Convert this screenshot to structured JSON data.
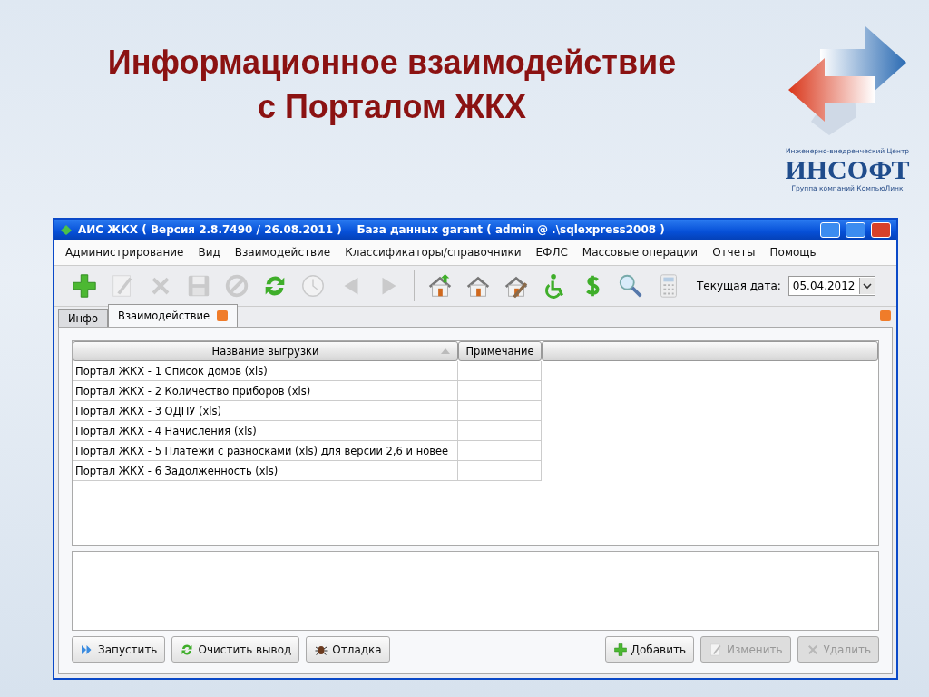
{
  "slide": {
    "title_lines": [
      "Информационное взаимодействие",
      "с Порталом ЖКХ"
    ],
    "logo": {
      "tagline": "Инженерно-внедренческий Центр",
      "name": "ИНСОФТ",
      "group": "Группа компаний КомпьюЛинк"
    }
  },
  "window": {
    "title": "АИС ЖКХ ( Версия 2.8.7490 / 26.08.2011 )    База данных garant ( admin @ .\\sqlexpress2008 )"
  },
  "menu": [
    "Администрирование",
    "Вид",
    "Взаимодействие",
    "Классификаторы/справочники",
    "ЕФЛС",
    "Массовые операции",
    "Отчеты",
    "Помощь"
  ],
  "toolbar": [
    {
      "kind": "add",
      "disabled": false
    },
    {
      "kind": "edit",
      "disabled": true
    },
    {
      "kind": "delete",
      "disabled": true
    },
    {
      "kind": "save",
      "disabled": true
    },
    {
      "kind": "cancel",
      "disabled": true
    },
    {
      "kind": "refresh",
      "disabled": false
    },
    {
      "kind": "clock",
      "disabled": true
    },
    {
      "kind": "prev",
      "disabled": true
    },
    {
      "kind": "next",
      "disabled": true
    },
    {
      "kind": "sep"
    },
    {
      "kind": "house-up",
      "disabled": false
    },
    {
      "kind": "house",
      "disabled": false
    },
    {
      "kind": "house-edit",
      "disabled": false
    },
    {
      "kind": "wheelchair",
      "disabled": false
    },
    {
      "kind": "dollar",
      "disabled": false
    },
    {
      "kind": "search",
      "disabled": false
    },
    {
      "kind": "calculator",
      "disabled": true
    }
  ],
  "date_field": {
    "label": "Текущая дата:",
    "value": "05.04.2012"
  },
  "tabs": [
    {
      "label": "Инфо",
      "selected": false,
      "closable": false
    },
    {
      "label": "Взаимодействие",
      "selected": true,
      "closable": true
    }
  ],
  "table": {
    "columns": [
      {
        "label": "Название выгрузки",
        "sorted": true
      },
      {
        "label": "Примечание",
        "sorted": false
      }
    ],
    "rows": [
      {
        "name": "Портал ЖКХ - 1 Список домов (xls)"
      },
      {
        "name": "Портал ЖКХ - 2 Количество приборов (xls)"
      },
      {
        "name": "Портал ЖКХ - 3 ОДПУ (xls)"
      },
      {
        "name": "Портал ЖКХ - 4 Начисления (xls)"
      },
      {
        "name": "Портал ЖКХ - 5 Платежи с разносками (xls) для версии 2,6 и новее"
      },
      {
        "name": "Портал ЖКХ - 6 Задолженность (xls)"
      }
    ]
  },
  "buttons_left": [
    {
      "label": "Запустить",
      "kind": "run",
      "disabled": false
    },
    {
      "label": "Очистить вывод",
      "kind": "refresh",
      "disabled": false
    },
    {
      "label": "Отладка",
      "kind": "bug",
      "disabled": false
    }
  ],
  "buttons_right": [
    {
      "label": "Добавить",
      "kind": "add",
      "disabled": false
    },
    {
      "label": "Изменить",
      "kind": "edit",
      "disabled": true
    },
    {
      "label": "Удалить",
      "kind": "delete",
      "disabled": true
    }
  ]
}
